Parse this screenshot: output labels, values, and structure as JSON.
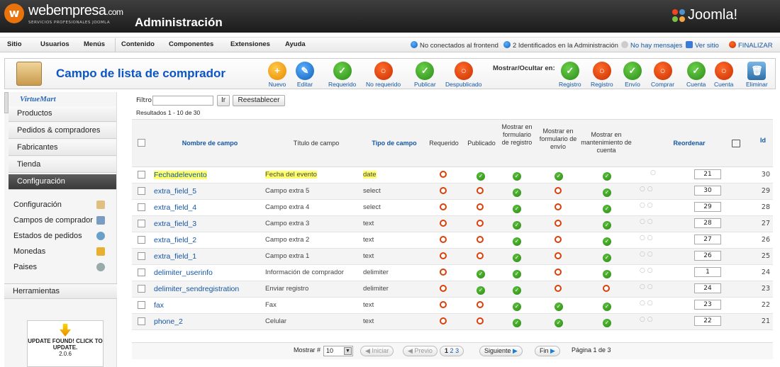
{
  "header": {
    "brand": "webempresa",
    "brand_suffix": ".com",
    "brand_sub": "SERVICIOS PROFESIONALES JOOMLA",
    "title": "Administración",
    "joomla": "Joomla!"
  },
  "menu": [
    "Sitio",
    "Usuarios",
    "Menús",
    "Contenido",
    "Componentes",
    "Extensiones",
    "Ayuda"
  ],
  "status": {
    "frontend": "No conectados al frontend",
    "admin": "2 Identificados en la Administración",
    "messages": "No hay mensajes",
    "view_site": "Ver sitio",
    "logout": "FINALIZAR"
  },
  "toolbar": {
    "title": "Campo de lista de comprador",
    "buttons": [
      "Nuevo",
      "Editar",
      "Requerido",
      "No requerido",
      "Publicar",
      "Despublicado"
    ],
    "show_hide_label": "Mostrar/Ocultar en:",
    "show_buttons": [
      "Registro",
      "Registro",
      "Envío",
      "Comprar",
      "Cuenta",
      "Cuenta"
    ],
    "delete": "Eliminar"
  },
  "sidebar": {
    "logo": "VirtueMart",
    "categories": [
      "Productos",
      "Pedidos & compradores",
      "Fabricantes",
      "Tienda",
      "Configuración"
    ],
    "links": [
      "Configuración",
      "Campos de comprador",
      "Estados de pedidos",
      "Monedas",
      "Paises"
    ],
    "tools": "Herramientas",
    "update": "UPDATE FOUND! CLICK TO UPDATE.",
    "version": "2.0.6"
  },
  "filter": {
    "label": "Filtro:",
    "go": "Ir",
    "reset": "Reestablecer",
    "results": "Resultados 1 - 10 de 30"
  },
  "columns": {
    "name": "Nombre de campo",
    "title": "Título de campo",
    "type": "Tipo de campo",
    "required": "Requerido",
    "published": "Publicado",
    "show_reg": "Mostrar en formulario de registro",
    "show_ship": "Mostrar en formulario de envío",
    "show_acct": "Mostrar en mantenimiento de cuenta",
    "reorder": "Reordenar",
    "id": "Id"
  },
  "rows": [
    {
      "name": "Fechadelevento",
      "title": "Fecha del evento",
      "type": "date",
      "req": false,
      "pub": true,
      "reg": true,
      "ship": true,
      "acct": true,
      "order": "21",
      "id": "30",
      "hl": true
    },
    {
      "name": "extra_field_5",
      "title": "Campo extra 5",
      "type": "select",
      "req": false,
      "pub": false,
      "reg": true,
      "ship": false,
      "acct": true,
      "order": "30",
      "id": "29"
    },
    {
      "name": "extra_field_4",
      "title": "Campo extra 4",
      "type": "select",
      "req": false,
      "pub": false,
      "reg": true,
      "ship": false,
      "acct": true,
      "order": "29",
      "id": "28"
    },
    {
      "name": "extra_field_3",
      "title": "Campo extra 3",
      "type": "text",
      "req": false,
      "pub": false,
      "reg": true,
      "ship": false,
      "acct": true,
      "order": "28",
      "id": "27"
    },
    {
      "name": "extra_field_2",
      "title": "Campo extra 2",
      "type": "text",
      "req": false,
      "pub": false,
      "reg": true,
      "ship": false,
      "acct": true,
      "order": "27",
      "id": "26"
    },
    {
      "name": "extra_field_1",
      "title": "Campo extra 1",
      "type": "text",
      "req": false,
      "pub": false,
      "reg": true,
      "ship": false,
      "acct": true,
      "order": "26",
      "id": "25"
    },
    {
      "name": "delimiter_userinfo",
      "title": "Información de comprador",
      "type": "delimiter",
      "req": false,
      "pub": true,
      "reg": true,
      "ship": false,
      "acct": true,
      "order": "1",
      "id": "24"
    },
    {
      "name": "delimiter_sendregistration",
      "title": "Enviar registro",
      "type": "delimiter",
      "req": false,
      "pub": true,
      "reg": true,
      "ship": false,
      "acct": false,
      "order": "24",
      "id": "23"
    },
    {
      "name": "fax",
      "title": "Fax",
      "type": "text",
      "req": false,
      "pub": false,
      "reg": true,
      "ship": true,
      "acct": true,
      "order": "23",
      "id": "22"
    },
    {
      "name": "phone_2",
      "title": "Celular",
      "type": "text",
      "req": false,
      "pub": false,
      "reg": true,
      "ship": true,
      "acct": true,
      "order": "22",
      "id": "21"
    }
  ],
  "pager": {
    "show": "Mostrar #",
    "limit": "10",
    "start": "Iniciar",
    "prev": "Previo",
    "pages": [
      "1",
      "2",
      "3"
    ],
    "next": "Siguiente",
    "end": "Fin",
    "page_of": "Página 1 de 3"
  },
  "colors": {
    "accent": "#1456a3",
    "title": "#0b55c4",
    "highlight": "#ffff6a",
    "green": "#2b8a17",
    "red": "#d9400a"
  }
}
